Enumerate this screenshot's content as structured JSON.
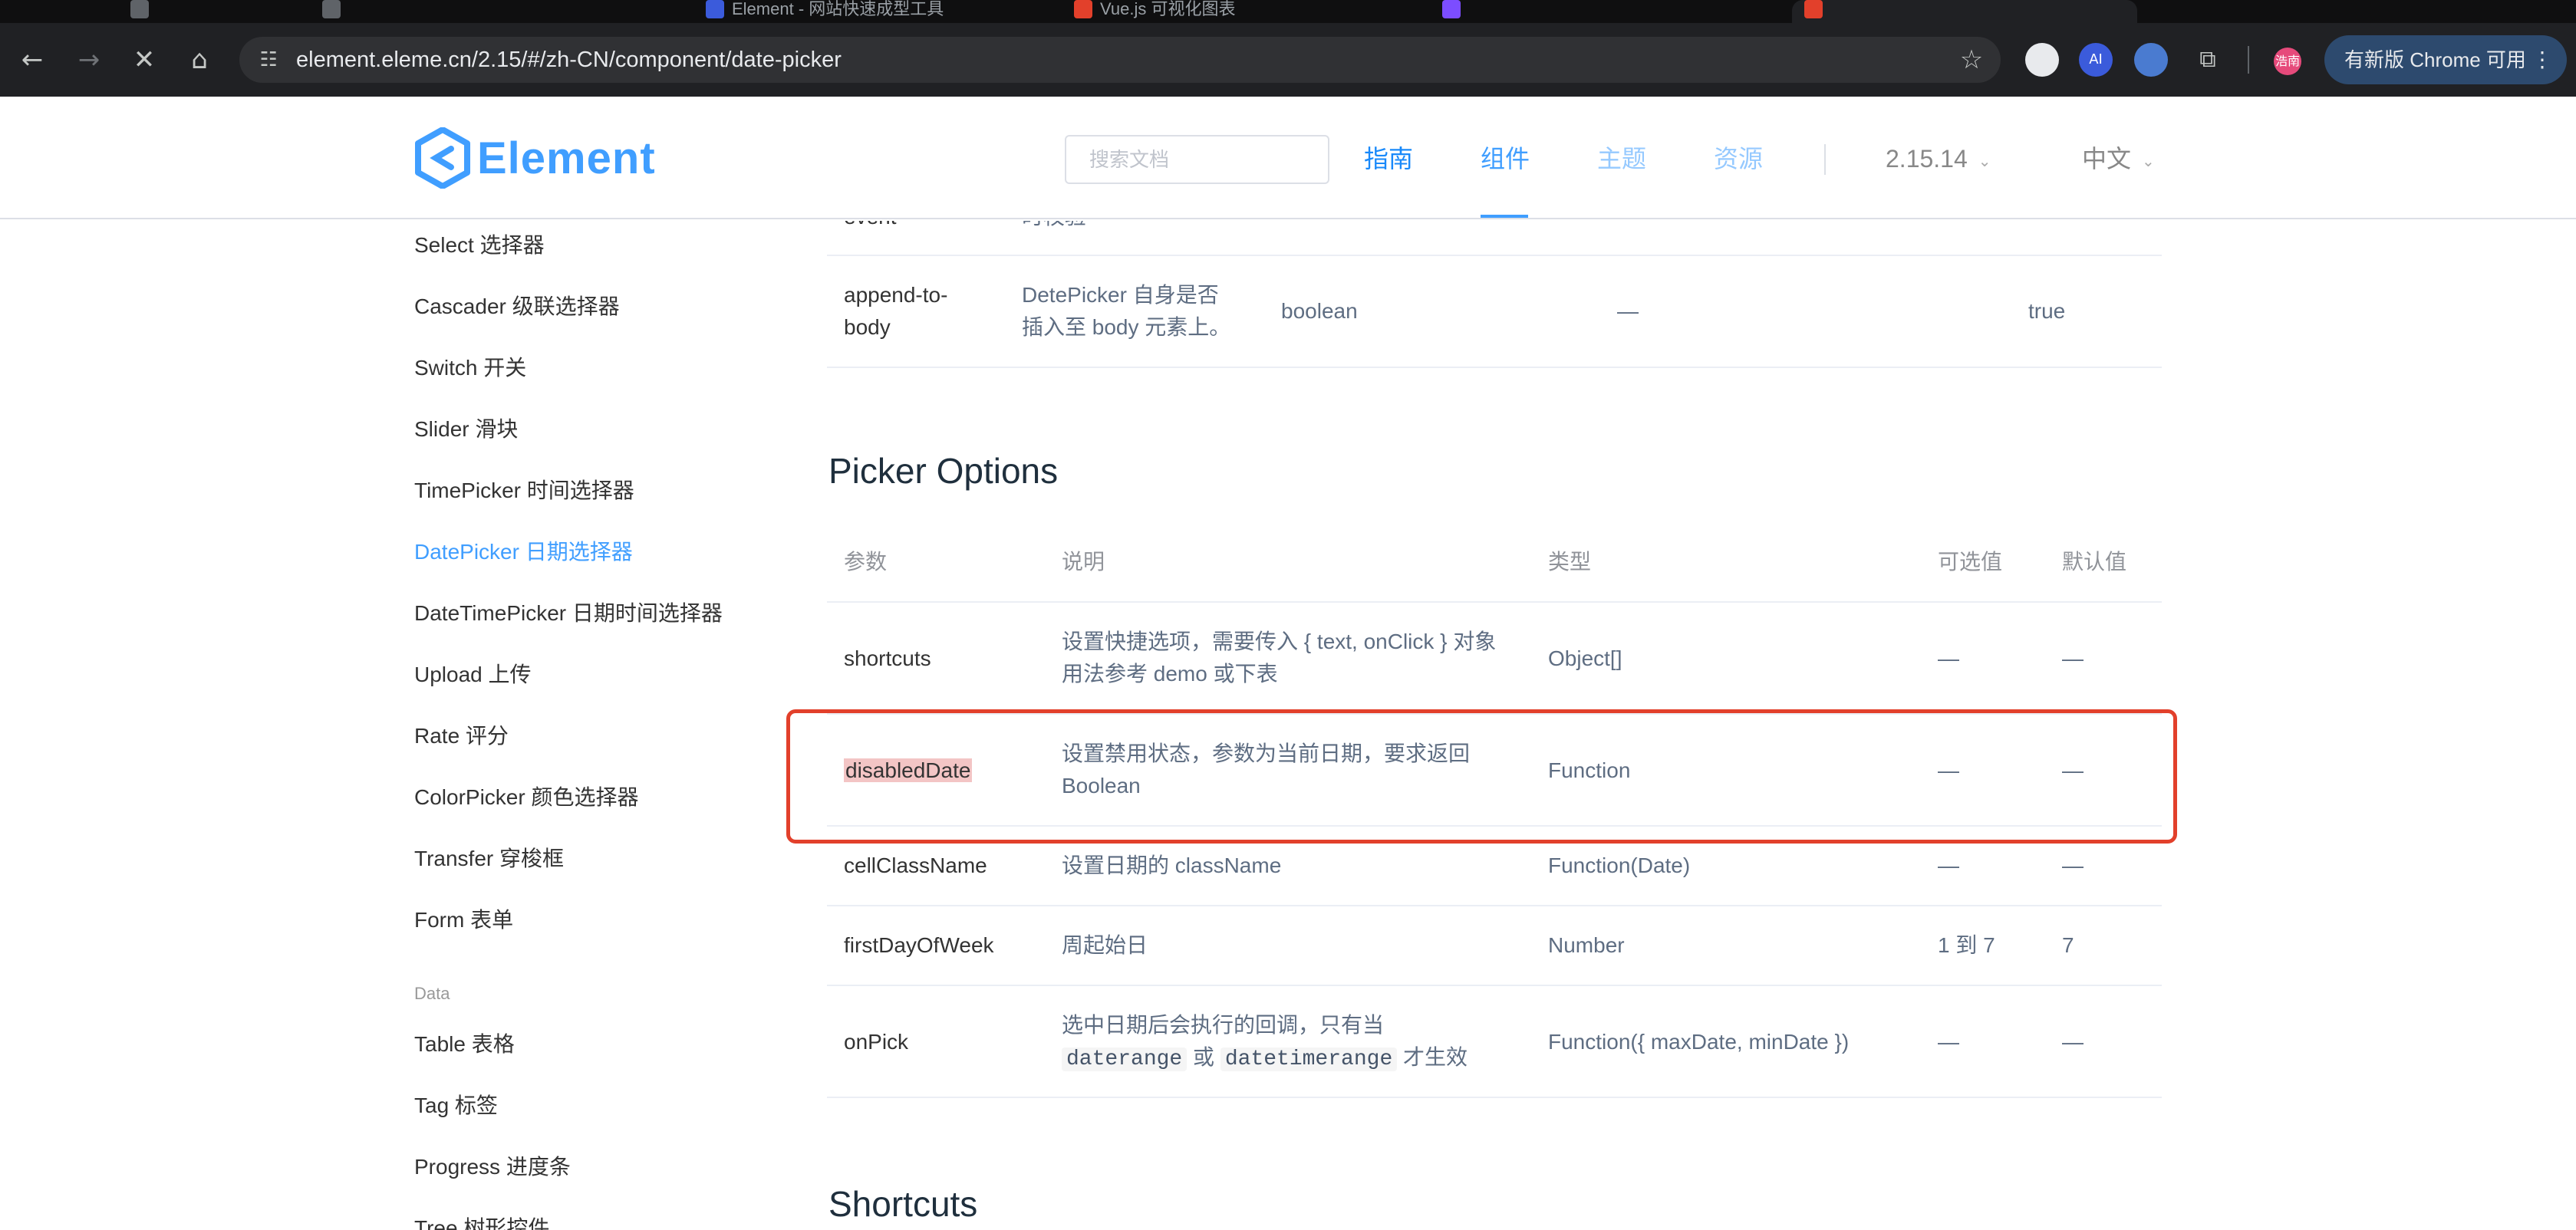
{
  "browser": {
    "tabs": [
      "",
      "",
      "Element - 网站快速成型工具",
      "",
      "Vue.js 可视化图表",
      "",
      "",
      ""
    ],
    "url": "element.eleme.cn/2.15/#/zh-CN/component/date-picker",
    "profile_badge": "浩南",
    "ext_ai": "AI",
    "update_label": "有新版 Chrome 可用",
    "colors": {
      "frame": "#202124",
      "omnibox": "#303134",
      "update": "#2d4a6e"
    }
  },
  "header": {
    "logo_text": "Element",
    "search_placeholder": "搜索文档",
    "nav": [
      "指南",
      "组件",
      "主题",
      "资源"
    ],
    "active_nav": "组件",
    "version": "2.15.14",
    "language": "中文",
    "accent": "#409eff"
  },
  "sidebar": {
    "items": [
      "Select 选择器",
      "Cascader 级联选择器",
      "Switch 开关",
      "Slider 滑块",
      "TimePicker 时间选择器",
      "DatePicker 日期选择器",
      "DateTimePicker 日期时间选择器",
      "Upload 上传",
      "Rate 评分",
      "ColorPicker 颜色选择器",
      "Transfer 穿梭框",
      "Form 表单"
    ],
    "group_data": "Data",
    "data_items": [
      "Table 表格",
      "Tag 标签",
      "Progress 进度条",
      "Tree 树形控件"
    ],
    "active_item": "DatePicker 日期选择器"
  },
  "attributes_table": {
    "partial_row": {
      "name": "event",
      "desc": "时校验"
    },
    "row": {
      "name_line1": "append-to-",
      "name_line2": "body",
      "desc_line1": "DetePicker 自身是否",
      "desc_line2": "插入至 body 元素上。",
      "type": "boolean",
      "options": "—",
      "default": "true"
    }
  },
  "picker_options": {
    "title": "Picker Options",
    "headers": [
      "参数",
      "说明",
      "类型",
      "可选值",
      "默认值"
    ],
    "rows": [
      {
        "name": "shortcuts",
        "desc_line1": "设置快捷选项，需要传入 { text, onClick } 对象",
        "desc_line2": "用法参考 demo 或下表",
        "type": "Object[]",
        "options": "—",
        "default": "—"
      },
      {
        "name": "disabledDate",
        "desc_line1": "设置禁用状态，参数为当前日期，要求返回",
        "desc_line2": "Boolean",
        "type": "Function",
        "options": "—",
        "default": "—"
      },
      {
        "name": "cellClassName",
        "desc_line1": "设置日期的 className",
        "desc_line2": "",
        "type": "Function(Date)",
        "options": "—",
        "default": "—"
      },
      {
        "name": "firstDayOfWeek",
        "desc_line1": "周起始日",
        "desc_line2": "",
        "type": "Number",
        "options": "1 到 7",
        "default": "7"
      },
      {
        "name": "onPick",
        "desc_line1": "选中日期后会执行的回调，只有当",
        "desc_code1": "daterange",
        "desc_or": "或",
        "desc_code2": "datetimerange",
        "desc_tail": "才生效",
        "type": "Function({ maxDate, minDate })",
        "options": "—",
        "default": "—"
      }
    ],
    "highlight_color": "#e2402b"
  },
  "shortcuts_section": {
    "title": "Shortcuts"
  }
}
